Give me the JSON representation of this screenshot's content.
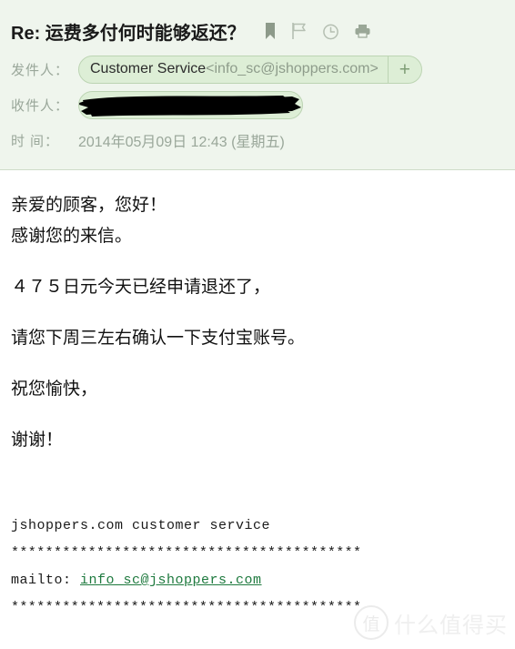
{
  "header": {
    "subject": "Re: 运费多付何时能够返还？",
    "icons": [
      {
        "name": "bookmark-icon",
        "label": "bookmark"
      },
      {
        "name": "flag-icon",
        "label": "flag"
      },
      {
        "name": "clock-icon",
        "label": "clock"
      },
      {
        "name": "print-icon",
        "label": "print"
      }
    ],
    "from": {
      "label": "发件人：",
      "display_name": "Customer Service",
      "email": "<info_sc@jshoppers.com>",
      "add_button": "+"
    },
    "to": {
      "label": "收件人：",
      "value": "",
      "redacted": true
    },
    "time": {
      "label_char1": "时",
      "label_char2": "间：",
      "value": "2014年05月09日 12:43 (星期五)"
    },
    "bg_color": "#eff5ed",
    "pill_color": "#ddeed6",
    "pill_border": "#bcd4b3"
  },
  "body": {
    "lines": [
      "亲爱的顾客，您好！",
      "感谢您的来信。",
      "",
      "４７５日元今天已经申请退还了，",
      "",
      "请您下周三左右确认一下支付宝账号。",
      "",
      "祝您愉快，",
      "",
      "谢谢！"
    ]
  },
  "signature": {
    "company_line": "jshoppers.com customer service",
    "divider_top": "*****************************************",
    "mailto_prefix": "mailto: ",
    "mailto_link": "info_sc@jshoppers.com",
    "divider_bottom": "*****************************************",
    "link_color": "#1f7a3f"
  },
  "watermark": {
    "logo_char": "值",
    "text": "什么值得买"
  }
}
